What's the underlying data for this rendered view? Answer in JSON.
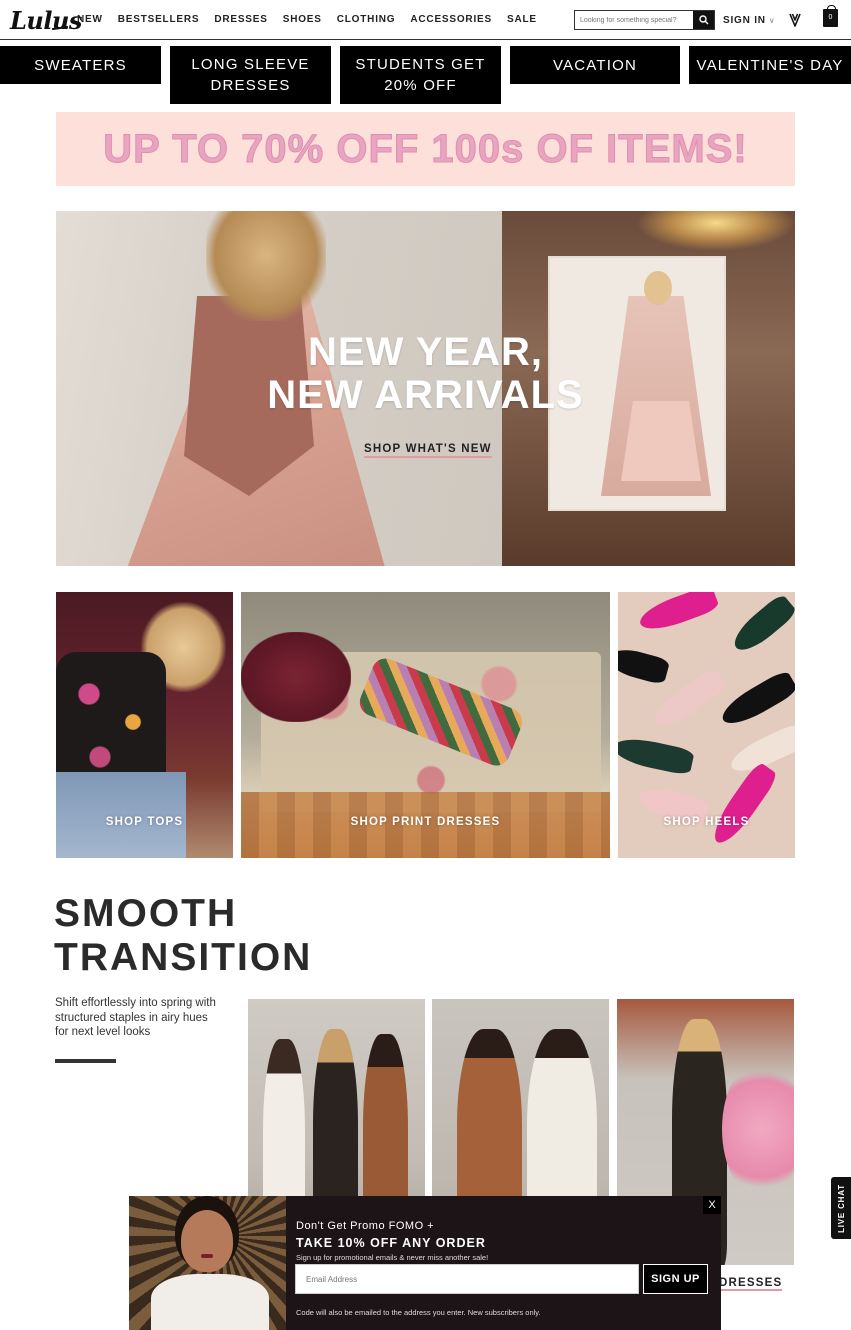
{
  "brand": {
    "logo_text": "Lulus"
  },
  "nav": {
    "items": [
      "NEW",
      "BESTSELLERS",
      "DRESSES",
      "SHOES",
      "CLOTHING",
      "ACCESSORIES",
      "SALE"
    ]
  },
  "search": {
    "placeholder": "Looking for something special?",
    "icon": "search-icon"
  },
  "account": {
    "signin_label": "SIGN IN",
    "chevron": "chevron-down-icon",
    "wishlist_icon": "heart-icon",
    "cart_icon": "shopping-bag-icon",
    "cart_count": "0"
  },
  "categories": [
    "SWEATERS",
    "LONG SLEEVE DRESSES",
    "STUDENTS GET 20% OFF",
    "VACATION",
    "VALENTINE'S DAY"
  ],
  "promo": {
    "text": "UP TO 70% OFF 100s OF ITEMS!",
    "color": "#e9a4c0",
    "bg": "#fde0da"
  },
  "hero": {
    "title_line1": "NEW YEAR,",
    "title_line2": "NEW ARRIVALS",
    "cta": "SHOP WHAT'S NEW"
  },
  "tiles": [
    {
      "label": "SHOP TOPS"
    },
    {
      "label": "SHOP PRINT DRESSES"
    },
    {
      "label": "SHOP HEELS"
    }
  ],
  "section": {
    "title_line1": "SMOOTH",
    "title_line2": "TRANSITION",
    "description": "Shift effortlessly into spring with structured staples in airy hues for next level looks",
    "photo_caption_partial": "DRESSES"
  },
  "live_chat": {
    "label": "LIVE CHAT"
  },
  "modal": {
    "kicker": "Don't Get Promo FOMO +",
    "title": "TAKE 10% OFF ANY ORDER",
    "subtitle": "Sign up for promotional emails & never miss another sale!",
    "email_placeholder": "Email Address",
    "button": "SIGN UP",
    "note": "Code will also be emailed to the address you enter. New subscribers only.",
    "close": "X"
  },
  "colors": {
    "accent_underline": "#e39aa3",
    "pill_bg": "#000000",
    "modal_bg": "#1d1418"
  }
}
